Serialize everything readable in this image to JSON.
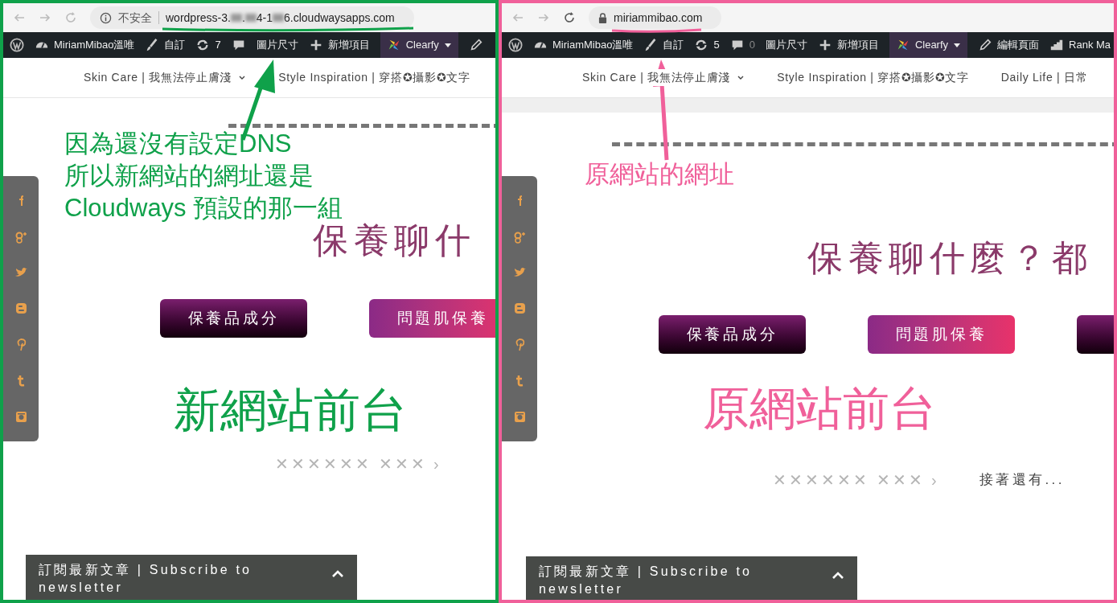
{
  "panels": [
    {
      "color": "#0fa14a",
      "address": {
        "secure": false,
        "security_label": "不安全",
        "url_segments": [
          {
            "kind": "text",
            "text": "wordpress-3."
          },
          {
            "kind": "redacted"
          },
          {
            "kind": "text",
            "text": "."
          },
          {
            "kind": "redacted"
          },
          {
            "kind": "text",
            "text": "4-1"
          },
          {
            "kind": "redacted"
          },
          {
            "kind": "text",
            "text": "6.cloudwaysapps.com"
          }
        ]
      },
      "admin_bar": [
        {
          "kind": "wp"
        },
        {
          "kind": "site",
          "label": "MiriamMibao溫唯"
        },
        {
          "kind": "customize",
          "label": "自訂"
        },
        {
          "kind": "updates",
          "label": "7"
        },
        {
          "kind": "comments"
        },
        {
          "kind": "text",
          "label": "圖片尺寸"
        },
        {
          "kind": "new",
          "label": "新增項目"
        },
        {
          "kind": "clearfy",
          "label": "Clearfy"
        },
        {
          "kind": "edit"
        }
      ],
      "nav": [
        {
          "label": "Skin Care | 我無法停止膚淺",
          "has_dropdown": true
        },
        {
          "label": "Style Inspiration | 穿搭✪攝影✪文字",
          "has_dropdown": false
        }
      ],
      "annotation": [
        "因為還沒有設定DNS",
        "所以新網站的網址還是",
        "Cloudways 預設的那一組"
      ],
      "headline": "保養聊什",
      "buttons": [
        {
          "kind": "dark",
          "label": "保養品成分"
        },
        {
          "kind": "pink",
          "label": "問題肌保養"
        }
      ],
      "caption": "新網站前台",
      "divider": "✕✕✕✕✕✕ ✕✕✕ ›",
      "subscribe": "訂閱最新文章 | Subscribe to newsletter"
    },
    {
      "color": "#f0609a",
      "address": {
        "secure": true,
        "url_segments": [
          {
            "kind": "text",
            "text": "miriammibao.com"
          }
        ]
      },
      "admin_bar": [
        {
          "kind": "wp"
        },
        {
          "kind": "site",
          "label": "MiriamMibao溫唯"
        },
        {
          "kind": "customize",
          "label": "自訂"
        },
        {
          "kind": "updates",
          "label": "5"
        },
        {
          "kind": "comments",
          "label": "0"
        },
        {
          "kind": "text",
          "label": "圖片尺寸"
        },
        {
          "kind": "new",
          "label": "新增項目"
        },
        {
          "kind": "clearfy",
          "label": "Clearfy"
        },
        {
          "kind": "edit",
          "label": "編輯頁面"
        },
        {
          "kind": "rank",
          "label": "Rank Ma"
        }
      ],
      "nav": [
        {
          "label": "Skin Care | 我無法停止膚淺",
          "has_dropdown": true
        },
        {
          "label": "Style Inspiration | 穿搭✪攝影✪文字",
          "has_dropdown": false
        },
        {
          "label": "Daily Life | 日常",
          "has_dropdown": false
        }
      ],
      "annotation": [
        "原網站的網址"
      ],
      "headline": "保養聊什麼？都",
      "buttons": [
        {
          "kind": "dark",
          "label": "保養品成分"
        },
        {
          "kind": "pink",
          "label": "問題肌保養"
        },
        {
          "kind": "dark"
        }
      ],
      "caption": "原網站前台",
      "divider": "✕✕✕✕✕✕ ✕✕✕ ›",
      "more_text": "接著還有...",
      "subscribe": "訂閱最新文章 | Subscribe to newsletter"
    }
  ]
}
